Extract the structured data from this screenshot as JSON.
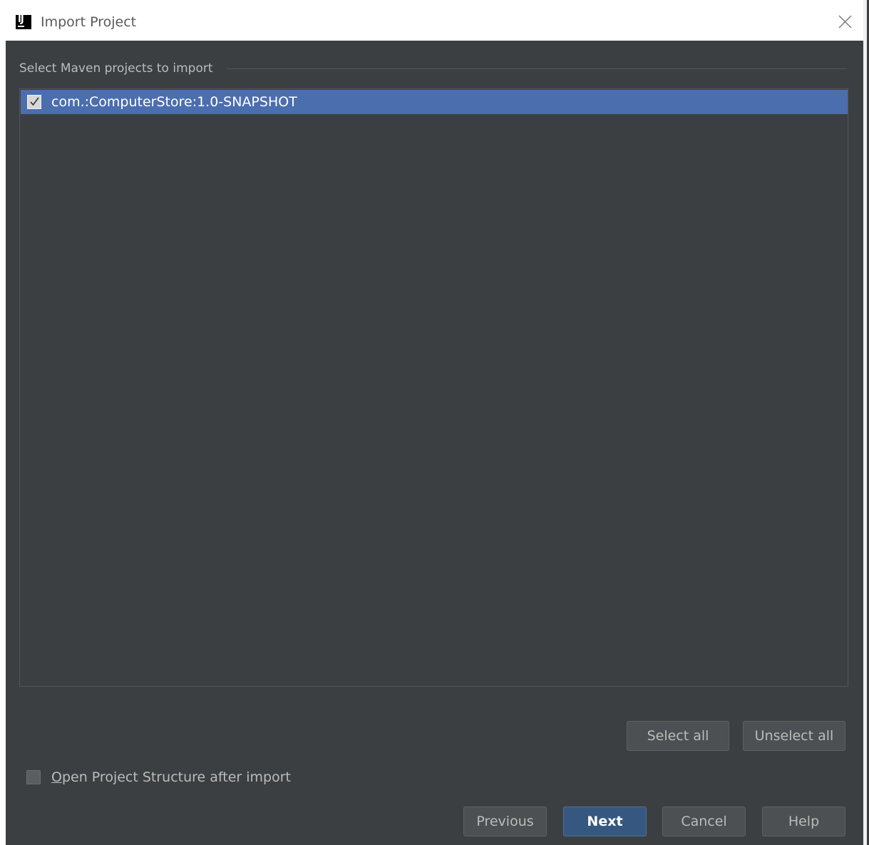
{
  "window": {
    "title": "Import Project",
    "icon": "intellij-icon",
    "icon_text": "IJ"
  },
  "section": {
    "title": "Select Maven projects to import"
  },
  "projects": [
    {
      "label": "com.:ComputerStore:1.0-SNAPSHOT",
      "checked": true,
      "selected": true
    }
  ],
  "selection_buttons": {
    "select_all": "Select all",
    "unselect_all": "Unselect all"
  },
  "options": {
    "open_structure_mnemonic": "O",
    "open_structure_rest": "pen Project Structure after import",
    "open_structure_checked": false
  },
  "footer": {
    "previous": "Previous",
    "next": "Next",
    "cancel": "Cancel",
    "help": "Help"
  },
  "colors": {
    "dialog_bg": "#3c3f41",
    "selection": "#4b6eaf",
    "primary_button": "#365880",
    "text": "#bbbbbb"
  }
}
